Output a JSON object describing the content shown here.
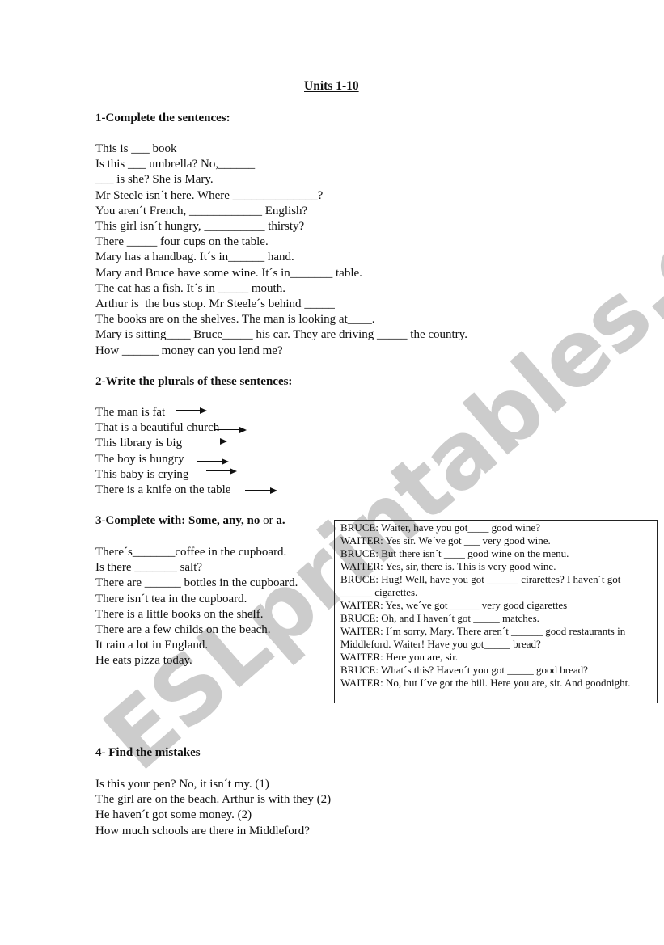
{
  "title": "Units 1-10",
  "watermark": "ESLprintables.com",
  "section1": {
    "heading": "1-Complete the sentences:",
    "lines": [
      [
        "This is ",
        "___",
        " book"
      ],
      [
        "Is this ",
        "___",
        " umbrella? No,",
        "______"
      ],
      [
        "___",
        " is she? She is Mary."
      ],
      [
        "Mr Steele isn´t here. Where ",
        "______________",
        "?"
      ],
      [
        "You aren´t French, ",
        "____________",
        " English?"
      ],
      [
        "This girl isn´t hungry, ",
        "__________",
        " thirsty?"
      ],
      [
        "There ",
        "_____",
        " four cups on the table."
      ],
      [
        "Mary has a handbag. It´s in",
        "______",
        " hand."
      ],
      [
        "Mary and Bruce have some wine. It´s in",
        "_______",
        " table."
      ],
      [
        "The cat has a fish. It´s in ",
        "_____",
        " mouth."
      ],
      [
        "Arthur is  the bus stop. Mr Steele´s behind ",
        "_____"
      ],
      [
        "The books are on the shelves. The man is looking at",
        "____",
        "."
      ],
      [
        "Mary is sitting",
        "____",
        " Bruce",
        "_____",
        " his car. They are driving ",
        "_____",
        " the country."
      ],
      [
        "How ",
        "______",
        " money can you lend me?"
      ]
    ]
  },
  "section2": {
    "heading": "2-Write the plurals of these sentences:",
    "lines": [
      "The man is fat",
      "That is a beautiful church",
      "This library is big",
      "The boy is hungry",
      "This baby is crying",
      "There is a knife on the table"
    ]
  },
  "section3": {
    "heading_prefix": "3-Complete with: ",
    "heading_words": "Some, any, no",
    "heading_or": " or ",
    "heading_a": "a.",
    "lines": [
      [
        "There´s",
        "_______",
        "coffee in the cupboard."
      ],
      [
        "Is there ",
        "_______",
        " salt?"
      ],
      [
        "There are ",
        "______",
        " bottles in the cupboard."
      ],
      [
        "There isn´t tea in the cupboard."
      ],
      [
        "There is a little books on the shelf."
      ],
      [
        "There are a few childs on the beach."
      ],
      [
        "It rain a lot in England."
      ],
      [
        "He eats pizza today."
      ]
    ],
    "dialog": [
      "BRUCE: Waiter, have you got____ good wine?",
      "WAITER: Yes sir. We´ve got ___ very good wine.",
      "BRUCE: But there isn´t ____ good wine on the menu.",
      "WAITER: Yes, sir, there is. This is very good wine.",
      "BRUCE: Hug! Well, have you got ______ cirarettes? I haven´t got ______ cigarettes.",
      "WAITER: Yes, we´ve got______ very good cigarettes",
      "BRUCE: Oh, and I haven´t got _____ matches.",
      "WAITER: I´m sorry, Mary. There aren´t ______ good restaurants in Middleford. Waiter! Have you got_____ bread?",
      "WAITER: Here you are, sir.",
      "BRUCE: What´s this? Haven´t you got _____ good bread?",
      "WAITER: No, but I´ve got the bill. Here you are, sir. And goodnight."
    ]
  },
  "section4": {
    "heading": "4- Find the mistakes",
    "lines": [
      "Is this your pen? No, it isn´t my. (1)",
      "The girl are on the beach. Arthur is with they (2)",
      "He haven´t got some money. (2)",
      "How much schools are there in Middleford?"
    ]
  }
}
